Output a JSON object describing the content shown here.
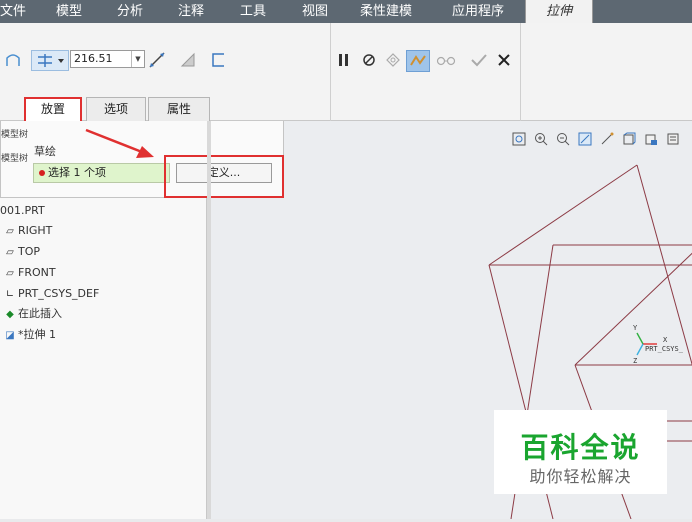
{
  "menu": {
    "tabs": [
      "文件",
      "模型",
      "分析",
      "注释",
      "工具",
      "视图",
      "柔性建模",
      "应用程序",
      "拉伸"
    ],
    "active_tab": "拉伸"
  },
  "ribbon": {
    "depth_value": "216.51"
  },
  "dashboard_tabs": [
    "放置",
    "选项",
    "属性"
  ],
  "panel": {
    "side_snip_1": "模型树",
    "side_snip_2": "模型树",
    "sketch_label": "草绘",
    "select_text": "选择 1 个项",
    "define_button": "定义..."
  },
  "tree": {
    "items": [
      "001.PRT",
      "RIGHT",
      "TOP",
      "FRONT",
      "PRT_CSYS_DEF",
      "在此插入",
      "*拉伸 1"
    ]
  },
  "csys": {
    "label": "PRT_CSYS_",
    "axis_x": "X",
    "axis_y": "Y",
    "axis_z": "Z"
  },
  "watermark": {
    "title": "百科全说",
    "subtitle": "助你轻松解决"
  },
  "colors": {
    "highlight_red": "#e03030",
    "watermark_green": "#1aa52f",
    "sketch_line": "#8c3b45"
  },
  "icons": [
    "sketch-surface-icon",
    "depth-type-icon",
    "flip-direction-icon",
    "remove-material-icon",
    "thicken-icon",
    "pause-icon",
    "no-preview-icon",
    "geometry-preview-icon",
    "verify-icon",
    "glasses-icon",
    "ok-check-icon",
    "cancel-x-icon"
  ]
}
